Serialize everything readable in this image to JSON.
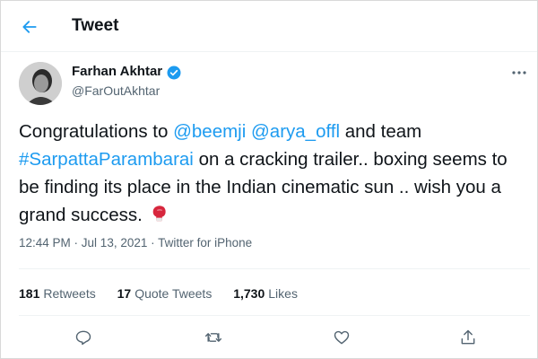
{
  "header": {
    "title": "Tweet"
  },
  "author": {
    "name": "Farhan Akhtar",
    "handle": "@FarOutAkhtar"
  },
  "tweet": {
    "text_1": "Congratulations to ",
    "mention_1": "@beemji",
    "text_2": " ",
    "mention_2": "@arya_offl",
    "text_3": " and team ",
    "hashtag": "#SarpattaParambarai",
    "text_4": " on a cracking trailer.. boxing seems to be finding its place in the Indian cinematic sun .. wish you a grand success. "
  },
  "meta": {
    "time": "12:44 PM",
    "dot": " · ",
    "date": "Jul 13, 2021",
    "source": "Twitter for iPhone"
  },
  "stats": {
    "retweets_count": "181",
    "retweets_label": "Retweets",
    "quotes_count": "17",
    "quotes_label": "Quote Tweets",
    "likes_count": "1,730",
    "likes_label": "Likes"
  },
  "icons": {
    "back": "arrow-left-icon",
    "verified": "verified-badge-icon",
    "more": "more-horizontal-icon",
    "glove": "boxing-glove-emoji",
    "reply": "reply-icon",
    "retweet": "retweet-icon",
    "like": "heart-icon",
    "share": "share-icon"
  },
  "colors": {
    "accent": "#1d9bf0",
    "text": "#0f1419",
    "muted": "#536471",
    "glove": "#d7263d"
  }
}
